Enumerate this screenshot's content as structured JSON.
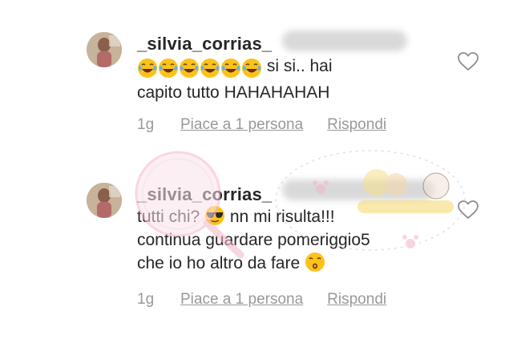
{
  "comments": [
    {
      "username": "_silvia_corrias_",
      "emoji_sequence": [
        "tears-of-joy",
        "tears-of-joy",
        "tears-of-joy",
        "tears-of-joy",
        "tears-of-joy",
        "tears-of-joy"
      ],
      "line1_after_emoji": " si si.. hai",
      "line2": "capito tutto HAHAHAHAH",
      "time": "1g",
      "likes_label": "Piace a 1 persona",
      "reply_label": "Rispondi"
    },
    {
      "username": "_silvia_corrias_",
      "line1_before_emoji": "tutti chi? ",
      "emoji1": "sunglasses",
      "line1_after_emoji": " nn mi risulta!!!",
      "line2": "continua guardare pomeriggio5",
      "line3_before_emoji": "che io ho altro da fare ",
      "emoji2": "kissing-face",
      "time": "1g",
      "likes_label": "Piace a 1 persona",
      "reply_label": "Rispondi"
    }
  ],
  "colors": {
    "text": "#262626",
    "meta": "#999999",
    "redaction": "#d3d3d3",
    "watermark_pink": "#f3b6c8"
  }
}
